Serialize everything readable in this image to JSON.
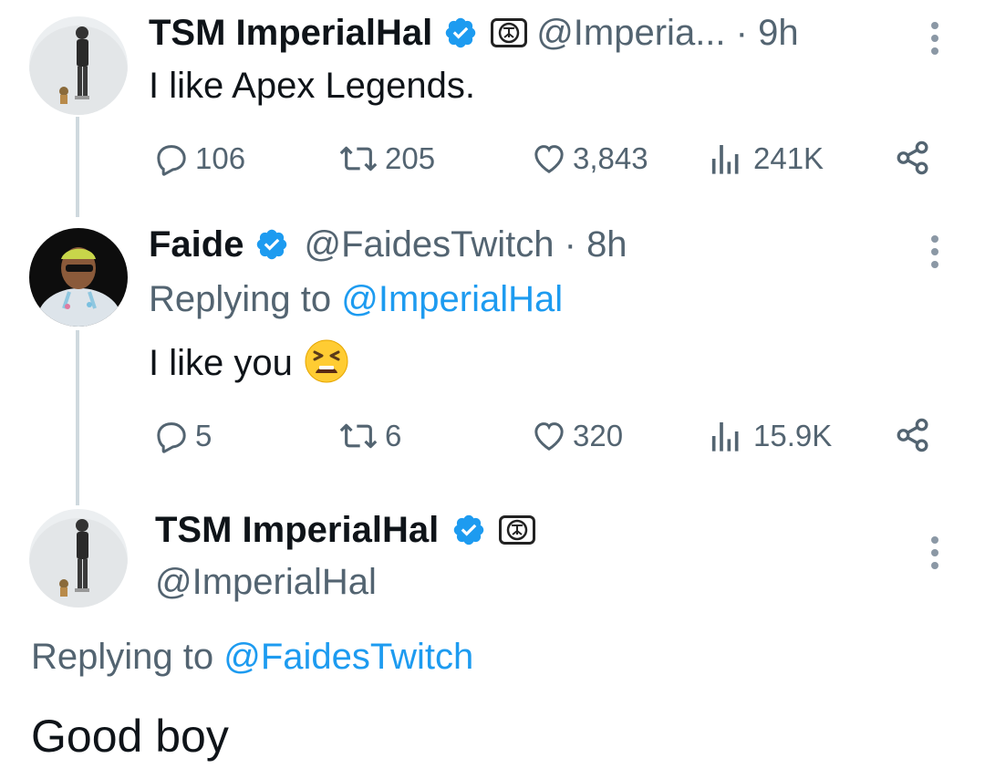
{
  "tweets": [
    {
      "name": "TSM ImperialHal",
      "handle": "@Imperia...",
      "sep": " · ",
      "time": "9h",
      "text": "I like Apex Legends.",
      "stats": {
        "replies": "106",
        "retweets": "205",
        "likes": "3,843",
        "views": "241K"
      }
    },
    {
      "name": "Faide",
      "handle": "@FaidesTwitch",
      "sep": " · ",
      "time": "8h",
      "replying_prefix": "Replying to ",
      "replying_to": "@ImperialHal",
      "text": "I like you",
      "stats": {
        "replies": "5",
        "retweets": "6",
        "likes": "320",
        "views": "15.9K"
      }
    },
    {
      "name": "TSM ImperialHal",
      "handle": "@ImperialHal",
      "replying_prefix": "Replying to ",
      "replying_to": "@FaidesTwitch",
      "text": "Good boy"
    }
  ],
  "colors": {
    "accent": "#1d9bf0",
    "muted": "#536471",
    "text": "#0f1419",
    "thread_line": "#cfd9de"
  },
  "icons": [
    "verified-badge-icon",
    "tsm-logo-icon",
    "more-icon",
    "reply-icon",
    "retweet-icon",
    "like-icon",
    "views-icon",
    "share-icon",
    "tired-face-emoji"
  ]
}
